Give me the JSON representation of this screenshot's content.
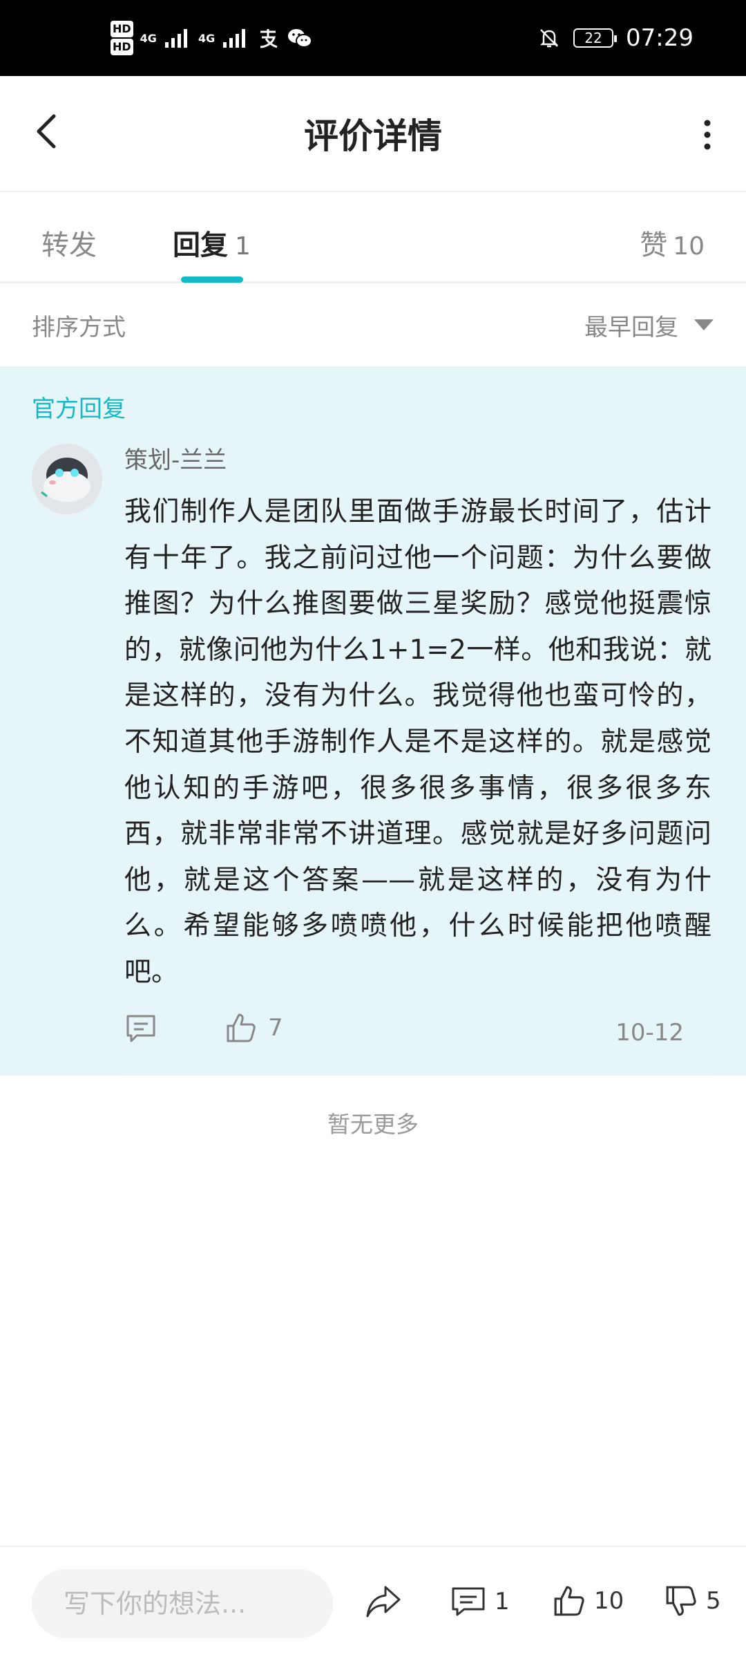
{
  "status_bar": {
    "time": "07:29",
    "battery": "22",
    "hd1": "HD",
    "hd2": "HD",
    "net": "4G"
  },
  "header": {
    "title": "评价详情"
  },
  "tabs": {
    "forward": "转发",
    "reply": "回复",
    "reply_count": "1",
    "likes": "赞",
    "likes_count": "10"
  },
  "sort": {
    "label": "排序方式",
    "selected": "最早回复"
  },
  "reply": {
    "section_label": "官方回复",
    "author": "策划-兰兰",
    "text": "我们制作人是团队里面做手游最长时间了，估计有十年了。我之前问过他一个问题：为什么要做推图？为什么推图要做三星奖励？感觉他挺震惊的，就像问他为什么1+1=2一样。他和我说：就是这样的，没有为什么。我觉得他也蛮可怜的，不知道其他手游制作人是不是这样的。就是感觉他认知的手游吧，很多很多事情，很多很多东西，就非常非常不讲道理。感觉就是好多问题问他，就是这个答案——就是这样的，没有为什么。希望能够多喷喷他，什么时候能把他喷醒吧。",
    "likes": "7",
    "date": "10-12"
  },
  "no_more": "暂无更多",
  "bottom_bar": {
    "placeholder": "写下你的想法...",
    "comment_count": "1",
    "like_count": "10",
    "dislike_count": "5"
  },
  "colors": {
    "accent": "#14b9c8",
    "reply_bg": "#e6f6f8"
  }
}
